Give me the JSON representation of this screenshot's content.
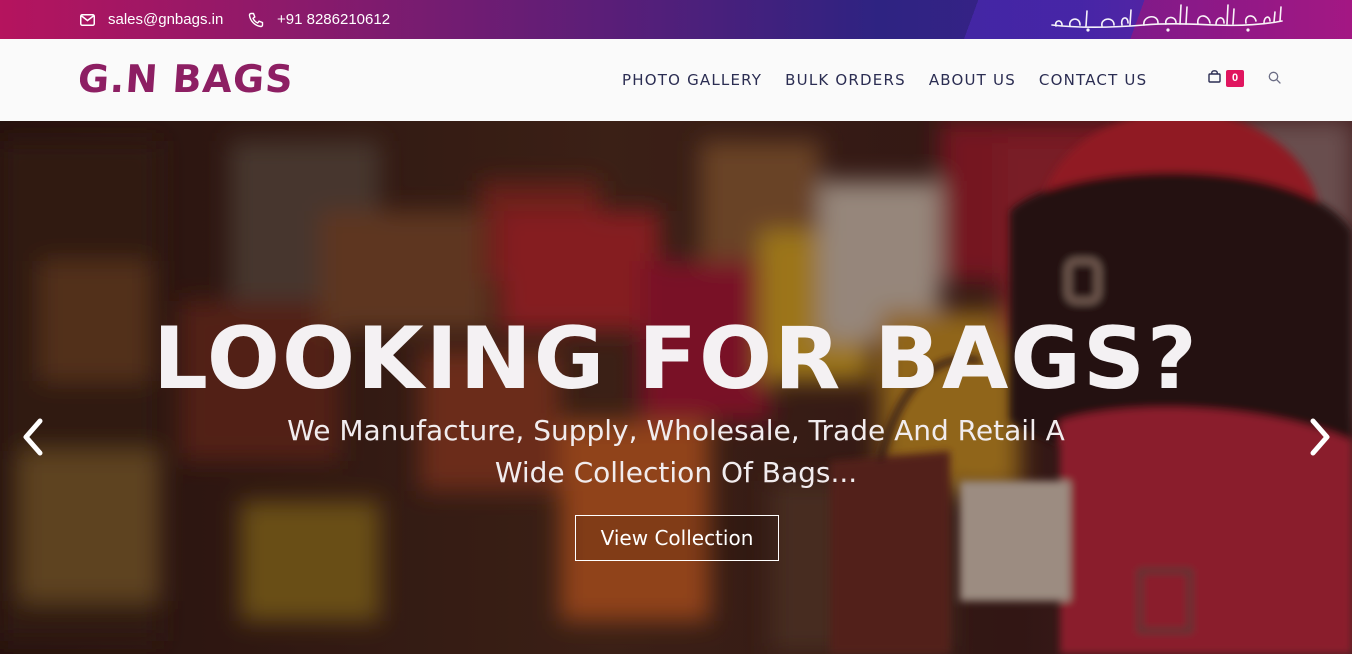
{
  "topbar": {
    "email": "sales@gnbags.in",
    "phone": "+91 8286210612",
    "email_icon": "envelope-icon",
    "phone_icon": "phone-icon",
    "calligraphy": "بسم الله الرحمن الرحيم"
  },
  "header": {
    "logo": "G.N BAGS",
    "nav": [
      "PHOTO GALLERY",
      "BULK ORDERS",
      "ABOUT US",
      "CONTACT US"
    ],
    "cart_count": "0",
    "cart_icon": "shopping-bag-icon",
    "search_icon": "search-icon"
  },
  "hero": {
    "title": "LOOKING FOR BAGS?",
    "subtitle": "We Manufacture, Supply, Wholesale, Trade And Retail A Wide Collection Of Bags...",
    "button": "View Collection",
    "prev_icon": "chevron-left-icon",
    "next_icon": "chevron-right-icon"
  },
  "colors": {
    "brand": "#8d1f63",
    "accent": "#e0155f",
    "nav_text": "#2b2d52"
  }
}
